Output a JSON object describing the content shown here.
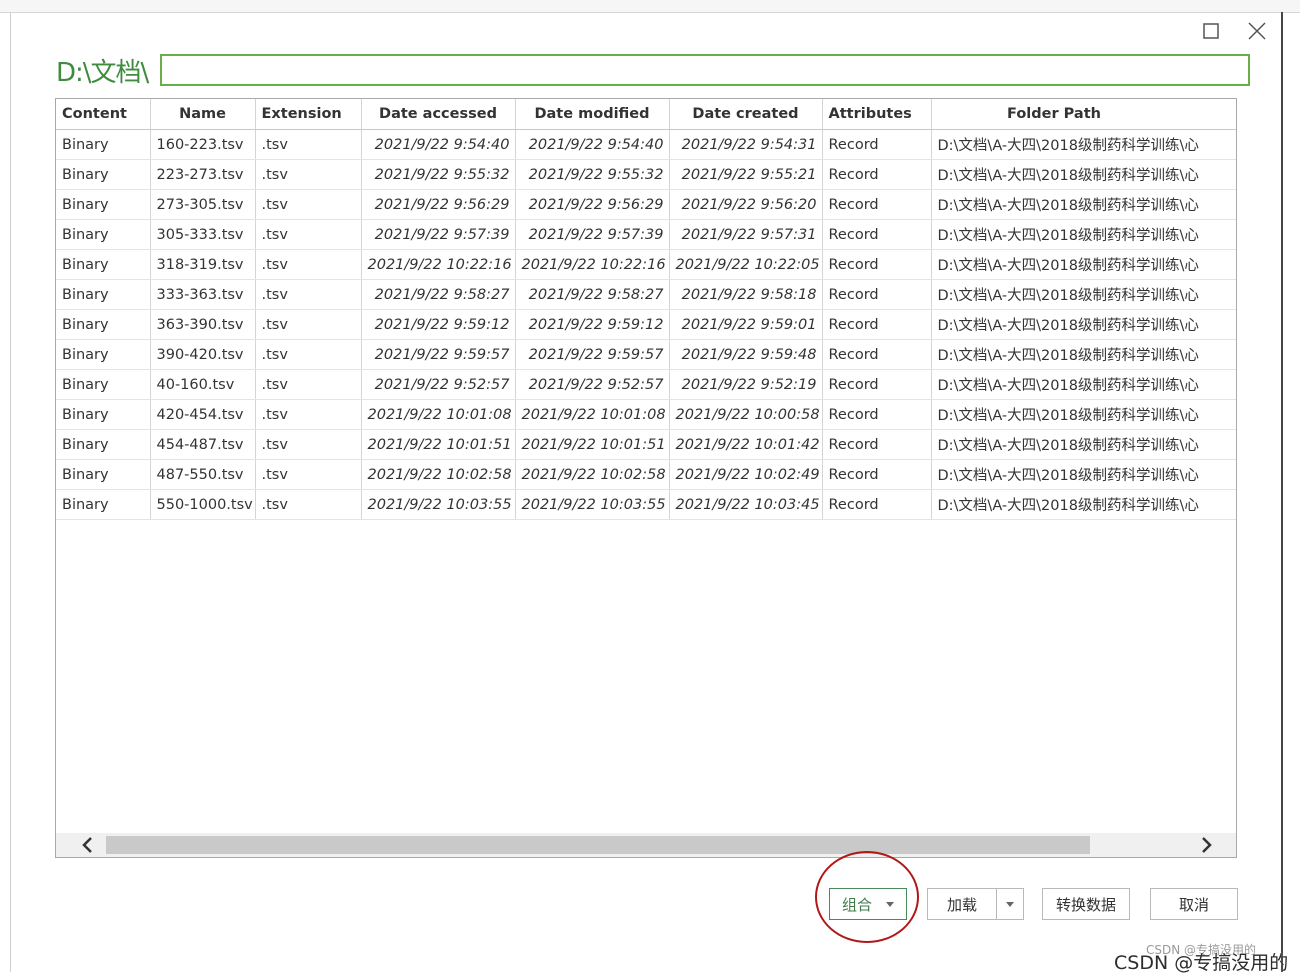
{
  "dialog": {
    "path_prefix": "D:\\文档\\",
    "path_input_value": ""
  },
  "table": {
    "columns": [
      "Content",
      "Name",
      "Extension",
      "Date accessed",
      "Date modified",
      "Date created",
      "Attributes",
      "Folder Path"
    ],
    "rows": [
      [
        "Binary",
        "160-223.tsv",
        ".tsv",
        "2021/9/22 9:54:40",
        "2021/9/22 9:54:40",
        "2021/9/22 9:54:31",
        "Record",
        "D:\\文档\\A-大四\\2018级制药科学训练\\心"
      ],
      [
        "Binary",
        "223-273.tsv",
        ".tsv",
        "2021/9/22 9:55:32",
        "2021/9/22 9:55:32",
        "2021/9/22 9:55:21",
        "Record",
        "D:\\文档\\A-大四\\2018级制药科学训练\\心"
      ],
      [
        "Binary",
        "273-305.tsv",
        ".tsv",
        "2021/9/22 9:56:29",
        "2021/9/22 9:56:29",
        "2021/9/22 9:56:20",
        "Record",
        "D:\\文档\\A-大四\\2018级制药科学训练\\心"
      ],
      [
        "Binary",
        "305-333.tsv",
        ".tsv",
        "2021/9/22 9:57:39",
        "2021/9/22 9:57:39",
        "2021/9/22 9:57:31",
        "Record",
        "D:\\文档\\A-大四\\2018级制药科学训练\\心"
      ],
      [
        "Binary",
        "318-319.tsv",
        ".tsv",
        "2021/9/22 10:22:16",
        "2021/9/22 10:22:16",
        "2021/9/22 10:22:05",
        "Record",
        "D:\\文档\\A-大四\\2018级制药科学训练\\心"
      ],
      [
        "Binary",
        "333-363.tsv",
        ".tsv",
        "2021/9/22 9:58:27",
        "2021/9/22 9:58:27",
        "2021/9/22 9:58:18",
        "Record",
        "D:\\文档\\A-大四\\2018级制药科学训练\\心"
      ],
      [
        "Binary",
        "363-390.tsv",
        ".tsv",
        "2021/9/22 9:59:12",
        "2021/9/22 9:59:12",
        "2021/9/22 9:59:01",
        "Record",
        "D:\\文档\\A-大四\\2018级制药科学训练\\心"
      ],
      [
        "Binary",
        "390-420.tsv",
        ".tsv",
        "2021/9/22 9:59:57",
        "2021/9/22 9:59:57",
        "2021/9/22 9:59:48",
        "Record",
        "D:\\文档\\A-大四\\2018级制药科学训练\\心"
      ],
      [
        "Binary",
        "40-160.tsv",
        ".tsv",
        "2021/9/22 9:52:57",
        "2021/9/22 9:52:57",
        "2021/9/22 9:52:19",
        "Record",
        "D:\\文档\\A-大四\\2018级制药科学训练\\心"
      ],
      [
        "Binary",
        "420-454.tsv",
        ".tsv",
        "2021/9/22 10:01:08",
        "2021/9/22 10:01:08",
        "2021/9/22 10:00:58",
        "Record",
        "D:\\文档\\A-大四\\2018级制药科学训练\\心"
      ],
      [
        "Binary",
        "454-487.tsv",
        ".tsv",
        "2021/9/22 10:01:51",
        "2021/9/22 10:01:51",
        "2021/9/22 10:01:42",
        "Record",
        "D:\\文档\\A-大四\\2018级制药科学训练\\心"
      ],
      [
        "Binary",
        "487-550.tsv",
        ".tsv",
        "2021/9/22 10:02:58",
        "2021/9/22 10:02:58",
        "2021/9/22 10:02:49",
        "Record",
        "D:\\文档\\A-大四\\2018级制药科学训练\\心"
      ],
      [
        "Binary",
        "550-1000.tsv",
        ".tsv",
        "2021/9/22 10:03:55",
        "2021/9/22 10:03:55",
        "2021/9/22 10:03:45",
        "Record",
        "D:\\文档\\A-大四\\2018级制药科学训练\\心"
      ]
    ]
  },
  "buttons": {
    "combine": "组合",
    "load": "加载",
    "transform": "转换数据",
    "cancel": "取消"
  },
  "icons": {
    "maximize": "maximize-icon",
    "close": "close-icon",
    "scroll_left": "chevron-left-icon",
    "scroll_right": "chevron-right-icon",
    "dropdown": "caret-down-icon"
  },
  "colors": {
    "path_label": "#3f8c3f",
    "input_border": "#6aae4a",
    "highlight_circle": "#b01818"
  },
  "watermark": {
    "text": "CSDN @专搞没用的",
    "faint_text": "CSDN @专搞没用的"
  }
}
